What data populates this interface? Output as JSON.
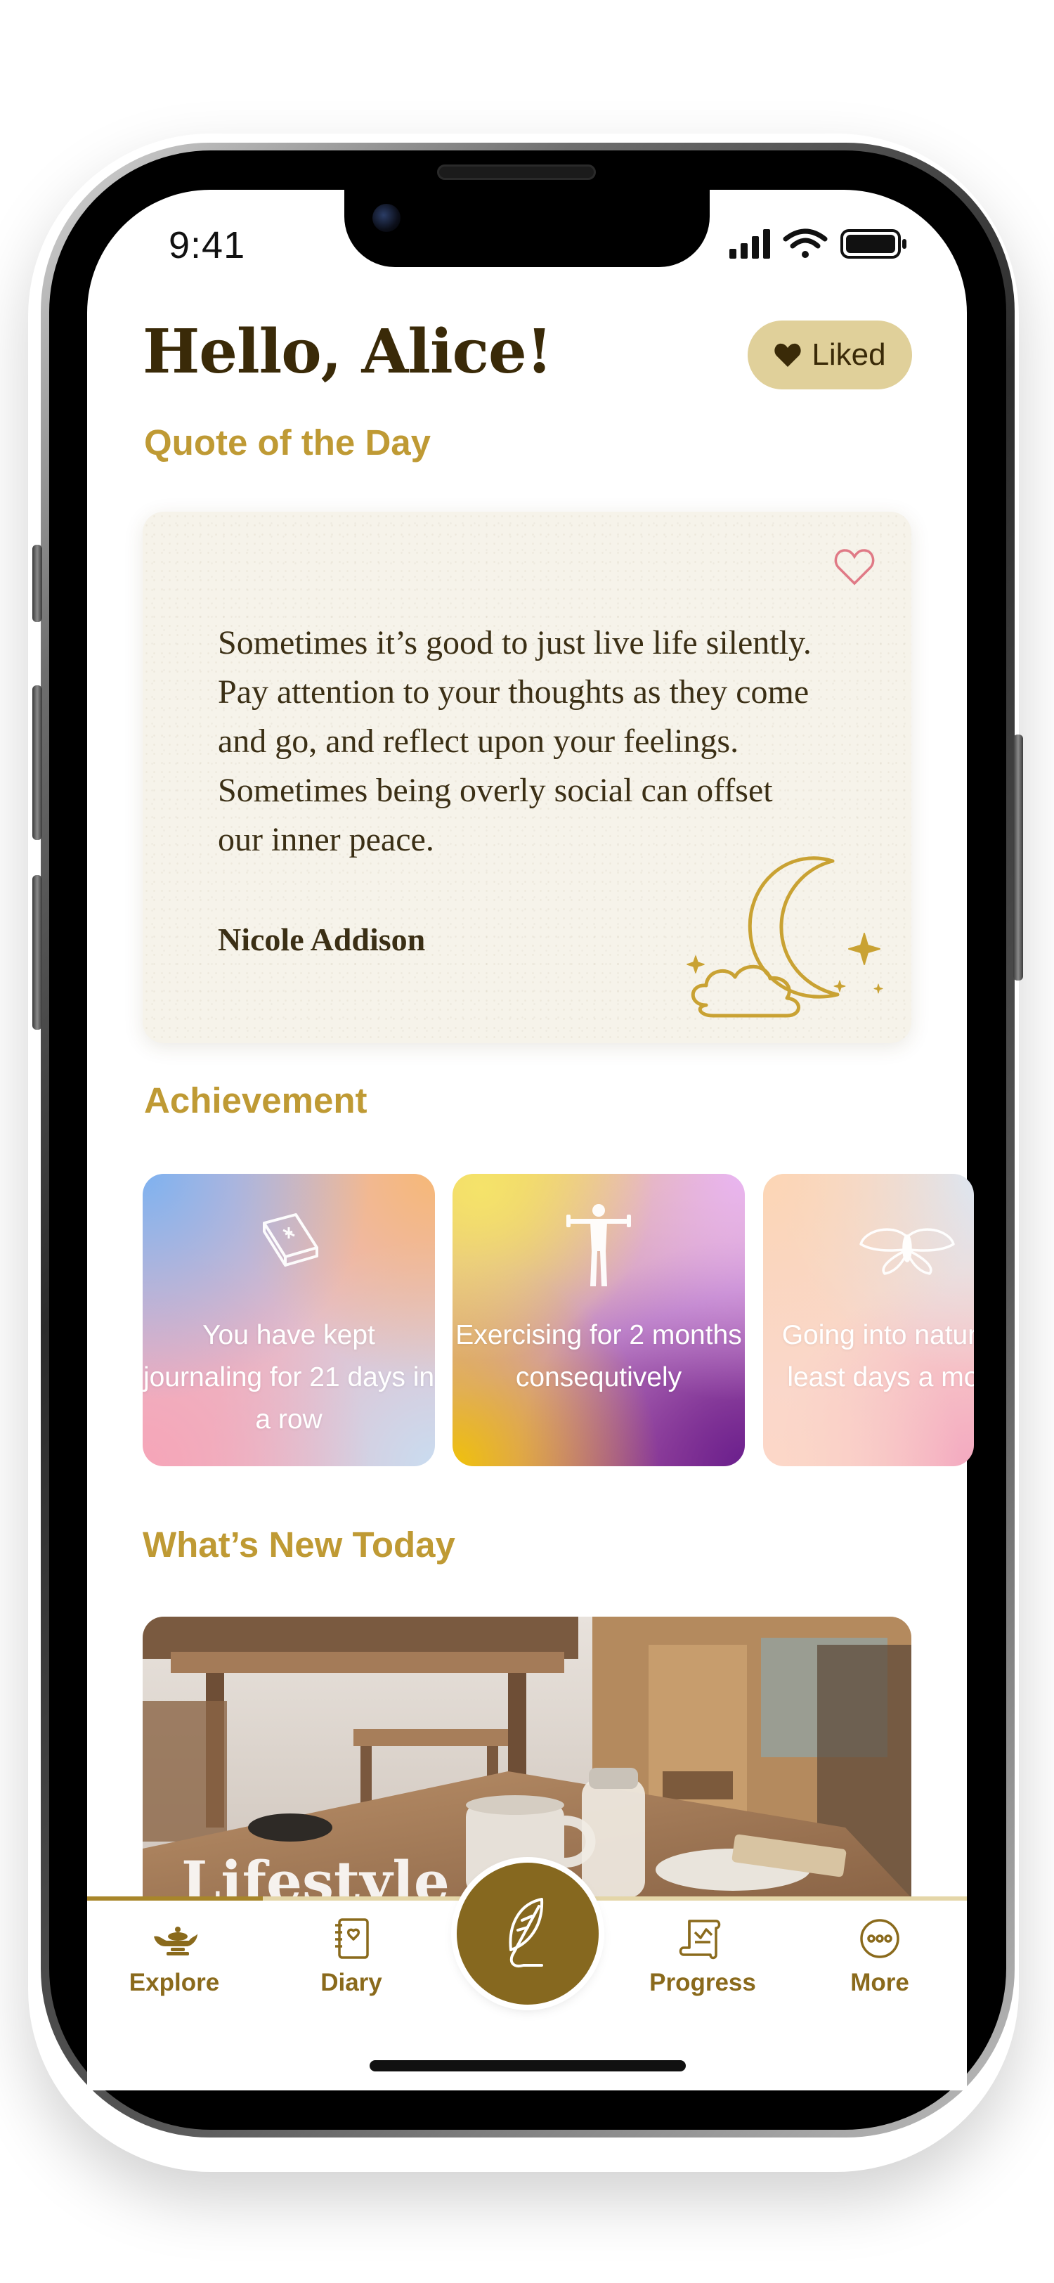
{
  "status_bar": {
    "time": "9:41"
  },
  "header": {
    "greeting": "Hello, Alice!",
    "liked_label": "Liked"
  },
  "quote_section": {
    "title": "Quote of the Day",
    "text": "Sometimes it’s good to just live life silently. Pay attention to your thoughts as they come and go, and reflect upon your feelings. Sometimes being overly social can offset our inner peace.",
    "author": "Nicole Addison"
  },
  "achievement_section": {
    "title": "Achievement",
    "cards": [
      {
        "text": "You have kept journaling for 21 days in a row",
        "icon": "book-icon"
      },
      {
        "text": "Exercising for 2 months consequtively",
        "icon": "person-exercise-icon"
      },
      {
        "text": "Going into nature at least days a month",
        "icon": "moth-icon"
      }
    ]
  },
  "news_section": {
    "title": "What’s New Today",
    "card_label": "Lifestyle"
  },
  "nav": {
    "items": [
      {
        "label": "Explore",
        "icon": "lamp-icon"
      },
      {
        "label": "Diary",
        "icon": "diary-icon"
      },
      {
        "label": "Progress",
        "icon": "scroll-icon"
      },
      {
        "label": "More",
        "icon": "more-icon"
      }
    ],
    "fab_icon": "feather-icon",
    "progress": 0.2
  },
  "colors": {
    "accent_gold": "#bf9a34",
    "dark_brown": "#3a2a08",
    "fab_brown": "#86681f",
    "liked_bg": "#e0d09a"
  }
}
